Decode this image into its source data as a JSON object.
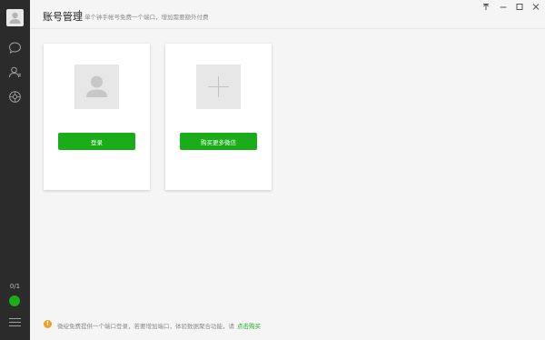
{
  "header": {
    "title": "账号管理",
    "subtitle": "单个钟手帐号免费一个端口，增加需要额外付费"
  },
  "window_controls": [
    "pin-icon",
    "minimize-icon",
    "maximize-icon",
    "close-icon"
  ],
  "sidebar": {
    "icons": [
      "chat-icon",
      "contacts-icon",
      "settings-icon"
    ],
    "count": "0/1",
    "status_color": "#1aad19"
  },
  "cards": [
    {
      "image": "person-placeholder-icon",
      "button_label": "登录"
    },
    {
      "image": "plus-icon",
      "button_label": "购买更多微信"
    }
  ],
  "footer": {
    "icon": "info-icon",
    "text": "微绽免费提供一个端口登录，若要增加端口，体验数据聚合功能，请",
    "link_label": "点击购买"
  },
  "colors": {
    "accent": "#1aad19",
    "sidebar": "#2b2b2b",
    "warning": "#f0a020"
  }
}
